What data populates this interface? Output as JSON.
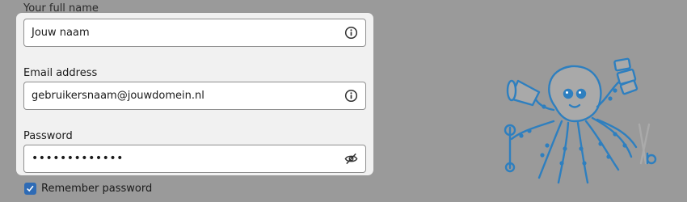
{
  "form": {
    "name_label": "Your full name",
    "name_value": "Jouw naam",
    "email_label": "Email address",
    "email_value": "gebruikersnaam@jouwdomein.nl",
    "password_label": "Password",
    "password_value": "•••••••••••••",
    "remember_label": "Remember password",
    "remember_checked": true
  },
  "icons": {
    "name_info": "info-circle-icon",
    "email_info": "info-circle-icon",
    "password_toggle": "eye-slash-icon",
    "checkbox": "checkmark-icon"
  },
  "mascot": {
    "name": "octopus-mascot-illustration"
  },
  "colors": {
    "overlay_background": "#9a9a9a",
    "panel_background": "#f1f1f1",
    "checkbox_accent": "#2e6bb5",
    "mascot_blue": "#2e7fbf"
  }
}
